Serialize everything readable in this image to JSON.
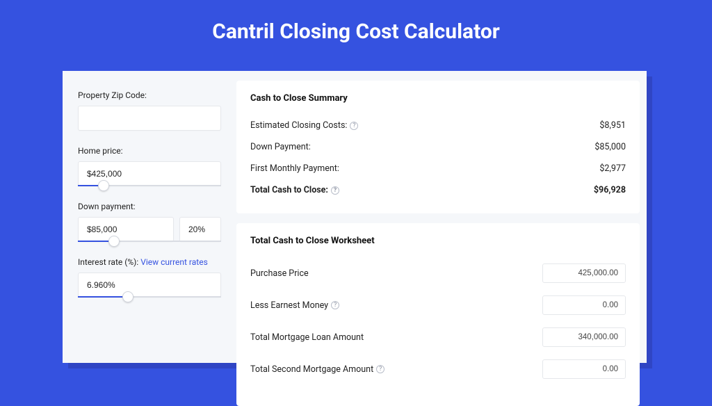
{
  "title": "Cantril Closing Cost Calculator",
  "sidebar": {
    "zip_label": "Property Zip Code:",
    "zip_value": "",
    "home_price_label": "Home price:",
    "home_price_value": "$425,000",
    "home_price_fill_pct": 18,
    "down_label": "Down payment:",
    "down_value": "$85,000",
    "down_pct": "20%",
    "down_fill_pct": 25,
    "rate_label": "Interest rate (%): ",
    "rate_link": "View current rates",
    "rate_value": "6.960%",
    "rate_fill_pct": 35
  },
  "summary": {
    "heading": "Cash to Close Summary",
    "rows": [
      {
        "label": "Estimated Closing Costs:",
        "help": true,
        "value": "$8,951",
        "bold": false
      },
      {
        "label": "Down Payment:",
        "help": false,
        "value": "$85,000",
        "bold": false
      },
      {
        "label": "First Monthly Payment:",
        "help": false,
        "value": "$2,977",
        "bold": false
      },
      {
        "label": "Total Cash to Close:",
        "help": true,
        "value": "$96,928",
        "bold": true
      }
    ]
  },
  "worksheet": {
    "heading": "Total Cash to Close Worksheet",
    "rows": [
      {
        "label": "Purchase Price",
        "help": false,
        "value": "425,000.00"
      },
      {
        "label": "Less Earnest Money",
        "help": true,
        "value": "0.00"
      },
      {
        "label": "Total Mortgage Loan Amount",
        "help": false,
        "value": "340,000.00"
      },
      {
        "label": "Total Second Mortgage Amount",
        "help": true,
        "value": "0.00"
      }
    ]
  }
}
